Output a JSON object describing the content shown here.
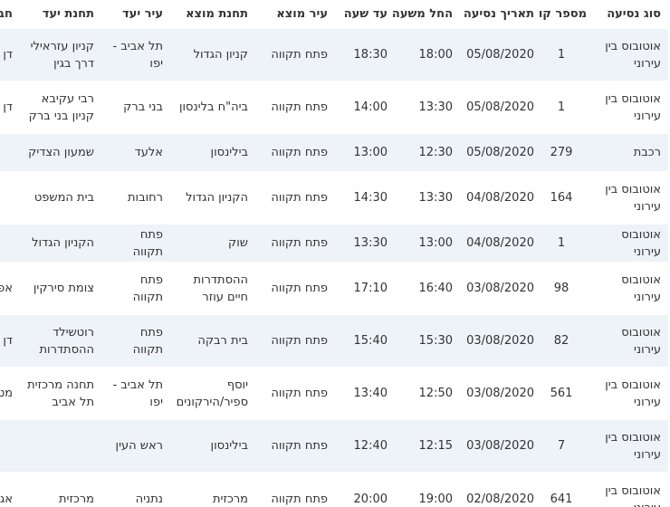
{
  "table": {
    "headers": [
      "סוג נסיעה",
      "מספר קו",
      "תאריך נסיעה",
      "החל משעה",
      "עד שעה",
      "עיר מוצא",
      "תחנת מוצא",
      "עיר יעד",
      "תחנת יעד",
      "חברה"
    ],
    "rows": [
      [
        "אוטובוס בין עירוני",
        "1",
        "05/08/2020",
        "18:00",
        "18:30",
        "פתח תקווה",
        "קניון הגדול",
        "תל אביב - יפו",
        "קניון עזראילי דרך בגין",
        "דן"
      ],
      [
        "אוטובוס בין עירוני",
        "1",
        "05/08/2020",
        "13:30",
        "14:00",
        "פתח תקווה",
        "ביה\"ח בלינסון",
        "בני ברק",
        "רבי עקיבא קניון בני ברק",
        "דן"
      ],
      [
        "רכבת",
        "279",
        "05/08/2020",
        "12:30",
        "13:00",
        "פתח תקווה",
        "בילינסון",
        "אלעד",
        "שמעון הצדיק",
        ""
      ],
      [
        "אוטובוס בין עירוני",
        "164",
        "04/08/2020",
        "13:30",
        "14:30",
        "פתח תקווה",
        "הקניון הגדול",
        "רחובות",
        "בית המשפט",
        ""
      ],
      [
        "אוטובוס עירוני",
        "1",
        "04/08/2020",
        "13:00",
        "13:30",
        "פתח תקווה",
        "שוק",
        "פתח תקווה",
        "הקניון הגדול",
        ""
      ],
      [
        "אוטובוס עירוני",
        "98",
        "03/08/2020",
        "16:40",
        "17:10",
        "פתח תקווה",
        "ההסתדרות חיים עוזר",
        "פתח תקווה",
        "צומת סירקין",
        "אפיקים"
      ],
      [
        "אוטובוס עירוני",
        "82",
        "03/08/2020",
        "15:30",
        "15:40",
        "פתח תקווה",
        "בית רבקה",
        "פתח תקווה",
        "רוטשילד ההסתדרות",
        "דן"
      ],
      [
        "אוטובוס בין עירוני",
        "561",
        "03/08/2020",
        "12:50",
        "13:40",
        "פתח תקווה",
        "יוסף ספיר/הירקונים",
        "תל אביב - יפו",
        "תחנה מרכזית תל אביב",
        "מטרופולין"
      ],
      [
        "אוטובוס בין עירוני",
        "7",
        "03/08/2020",
        "12:15",
        "12:40",
        "פתח תקווה",
        "בילינסון",
        "ראש העין",
        "",
        ""
      ],
      [
        "אוטובוס בין עירוני",
        "641",
        "02/08/2020",
        "19:00",
        "20:00",
        "פתח תקווה",
        "מרכזית",
        "נתניה",
        "מרכזית",
        "אגד"
      ]
    ]
  }
}
